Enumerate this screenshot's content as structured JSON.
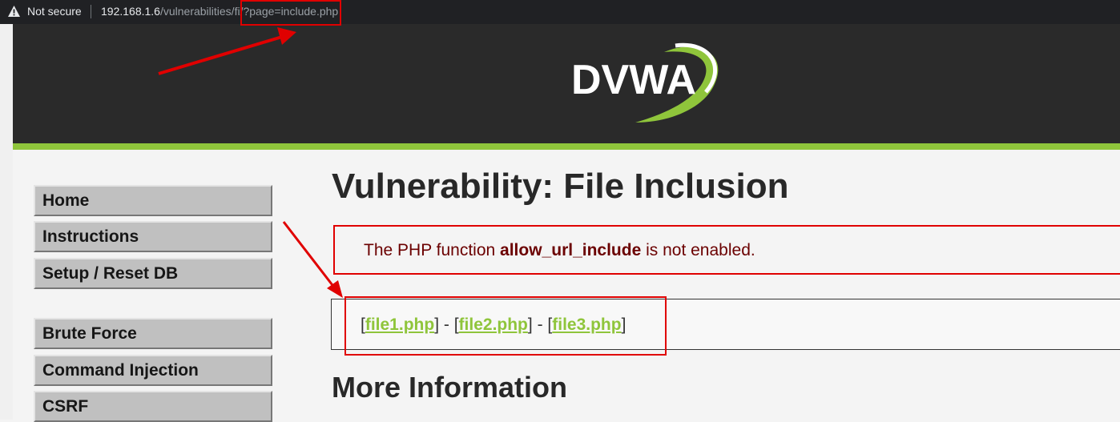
{
  "browser": {
    "security_label": "Not secure",
    "url_host": "192.168.1.6",
    "url_path": "/vulnerabilities/fi/",
    "url_query": "?page=include.php"
  },
  "header": {
    "logo_text": "DVWA",
    "accent_color": "#8fc53b"
  },
  "menu": {
    "items": [
      {
        "label": "Home"
      },
      {
        "label": "Instructions"
      },
      {
        "label": "Setup / Reset DB"
      },
      {
        "label": "Brute Force"
      },
      {
        "label": "Command Injection"
      },
      {
        "label": "CSRF"
      }
    ]
  },
  "main": {
    "title": "Vulnerability: File Inclusion",
    "warning": {
      "prefix": "The PHP function ",
      "function_name": "allow_url_include",
      "suffix": " is not enabled."
    },
    "files": {
      "open": "[",
      "close": "]",
      "separator": " - ",
      "links": [
        "file1.php",
        "file2.php",
        "file3.php"
      ]
    },
    "more_info_heading": "More Information"
  },
  "annotation_color": "#e00000"
}
